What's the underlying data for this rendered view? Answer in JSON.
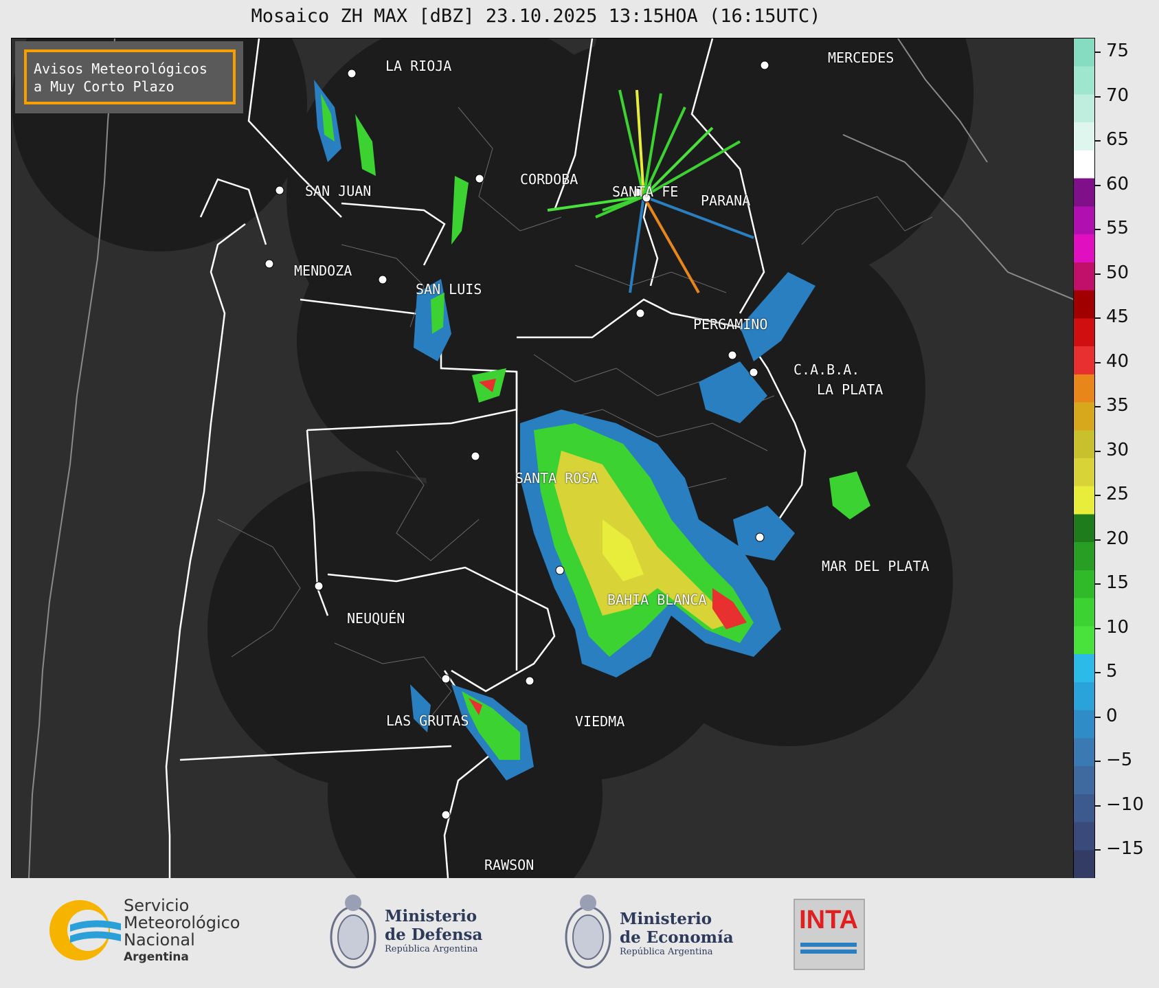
{
  "title": "Mosaico ZH MAX [dBZ] 23.10.2025 13:15HOA (16:15UTC)",
  "notice": {
    "line1": "Avisos Meteorológicos",
    "line2": "a Muy Corto Plazo"
  },
  "cities": [
    {
      "name": "LA RIOJA"
    },
    {
      "name": "MERCEDES"
    },
    {
      "name": "SAN JUAN"
    },
    {
      "name": "CORDOBA"
    },
    {
      "name": "SANTA FE"
    },
    {
      "name": "PARANA"
    },
    {
      "name": "MENDOZA"
    },
    {
      "name": "SAN LUIS"
    },
    {
      "name": "PERGAMINO"
    },
    {
      "name": "C.A.B.A."
    },
    {
      "name": "LA PLATA"
    },
    {
      "name": "SANTA ROSA"
    },
    {
      "name": "MAR DEL PLATA"
    },
    {
      "name": "BAHIA BLANCA"
    },
    {
      "name": "NEUQUÉN"
    },
    {
      "name": "LAS GRUTAS"
    },
    {
      "name": "VIEDMA"
    },
    {
      "name": "RAWSON"
    }
  ],
  "colorbar": {
    "ticks": [
      "75",
      "70",
      "65",
      "60",
      "55",
      "50",
      "45",
      "40",
      "35",
      "30",
      "25",
      "20",
      "15",
      "10",
      "5",
      "0",
      "−5",
      "−10",
      "−15"
    ],
    "colors": [
      "#323c64",
      "#3a4a7a",
      "#3c5a8e",
      "#3f6aa0",
      "#3a79b2",
      "#2f8cc6",
      "#2aa3da",
      "#2cbbe8",
      "#49e23c",
      "#3cd232",
      "#30ba2a",
      "#289e24",
      "#1e7c1c",
      "#e8ec3a",
      "#d8d438",
      "#c8c02c",
      "#d8a81c",
      "#e8861a",
      "#e83030",
      "#d01010",
      "#a00000",
      "#c0106a",
      "#e010c0",
      "#b010b0",
      "#80108a",
      "#ffffff",
      "#dff6ee",
      "#bfeedf",
      "#9fe6cf",
      "#86dcc0"
    ]
  },
  "logos": {
    "smn": {
      "line1": "Servicio",
      "line2": "Meteorológico",
      "line3": "Nacional",
      "line4": "Argentina"
    },
    "defensa": {
      "line1": "Ministerio",
      "line2": "de Defensa",
      "line3": "República Argentina"
    },
    "economia": {
      "line1": "Ministerio",
      "line2": "de Economía",
      "line3": "República Argentina"
    },
    "inta": {
      "label": "INTA"
    }
  }
}
